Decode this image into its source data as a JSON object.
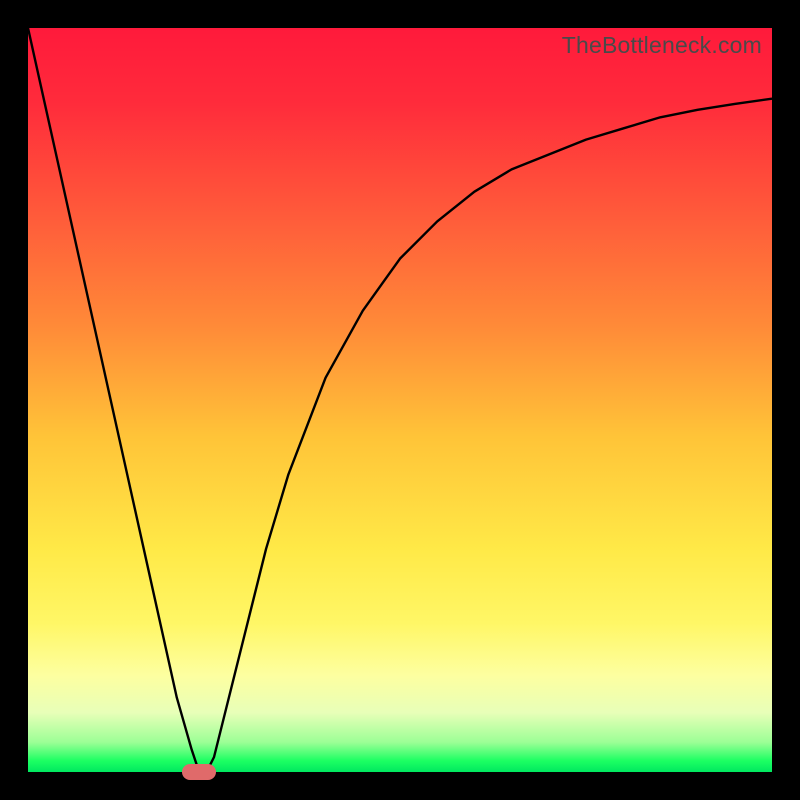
{
  "watermark": "TheBottleneck.com",
  "chart_data": {
    "type": "line",
    "title": "",
    "xlabel": "",
    "ylabel": "",
    "xlim": [
      0,
      100
    ],
    "ylim": [
      0,
      100
    ],
    "grid": false,
    "legend": false,
    "series": [
      {
        "name": "bottleneck-curve",
        "x": [
          0,
          2,
          4,
          6,
          8,
          10,
          12,
          14,
          16,
          18,
          20,
          22,
          23,
          24,
          25,
          26,
          28,
          30,
          32,
          35,
          40,
          45,
          50,
          55,
          60,
          65,
          70,
          75,
          80,
          85,
          90,
          95,
          100
        ],
        "values": [
          100,
          91,
          82,
          73,
          64,
          55,
          46,
          37,
          28,
          19,
          10,
          3,
          0,
          0,
          2,
          6,
          14,
          22,
          30,
          40,
          53,
          62,
          69,
          74,
          78,
          81,
          83,
          85,
          86.5,
          88,
          89,
          89.8,
          90.5
        ]
      }
    ],
    "marker": {
      "name": "bottleneck-point",
      "x": 23,
      "y": 0,
      "color": "#e06a6a"
    },
    "background_gradient": {
      "type": "vertical",
      "stops": [
        {
          "pos": 0.0,
          "color": "#ff1a3b"
        },
        {
          "pos": 0.1,
          "color": "#ff2b3b"
        },
        {
          "pos": 0.25,
          "color": "#ff5a3a"
        },
        {
          "pos": 0.4,
          "color": "#ff8a38"
        },
        {
          "pos": 0.55,
          "color": "#ffc438"
        },
        {
          "pos": 0.7,
          "color": "#ffe947"
        },
        {
          "pos": 0.8,
          "color": "#fff766"
        },
        {
          "pos": 0.87,
          "color": "#fdffa0"
        },
        {
          "pos": 0.92,
          "color": "#e8ffb8"
        },
        {
          "pos": 0.96,
          "color": "#9cff96"
        },
        {
          "pos": 0.985,
          "color": "#1cff62"
        },
        {
          "pos": 1.0,
          "color": "#00e860"
        }
      ]
    }
  }
}
